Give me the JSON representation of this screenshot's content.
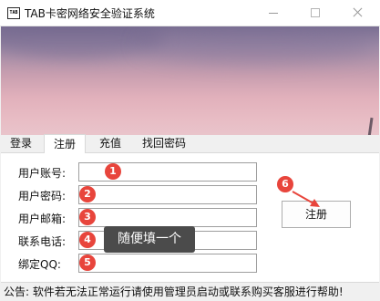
{
  "window": {
    "icon_text": "TAB",
    "title": "TAB卡密网络安全验证系统"
  },
  "tabs": [
    {
      "label": "登录"
    },
    {
      "label": "注册"
    },
    {
      "label": "充值"
    },
    {
      "label": "找回密码"
    }
  ],
  "form": {
    "fields": [
      {
        "label": "用户账号:",
        "value": "",
        "badge": "1"
      },
      {
        "label": "用户密码:",
        "value": "",
        "badge": "2"
      },
      {
        "label": "用户邮箱:",
        "value": "",
        "badge": "3"
      },
      {
        "label": "联系电话:",
        "value": "",
        "badge": "4"
      },
      {
        "label": "绑定QQ:",
        "value": "",
        "badge": "5"
      }
    ],
    "submit_label": "注册",
    "submit_badge": "6",
    "tooltip": "随便填一个"
  },
  "colors": {
    "badge": "#e8453c",
    "tooltip_bg": "#4b4b4b"
  },
  "status_text": "公告: 软件若无法正常运行请使用管理员启动或联系购买客服进行帮助!"
}
